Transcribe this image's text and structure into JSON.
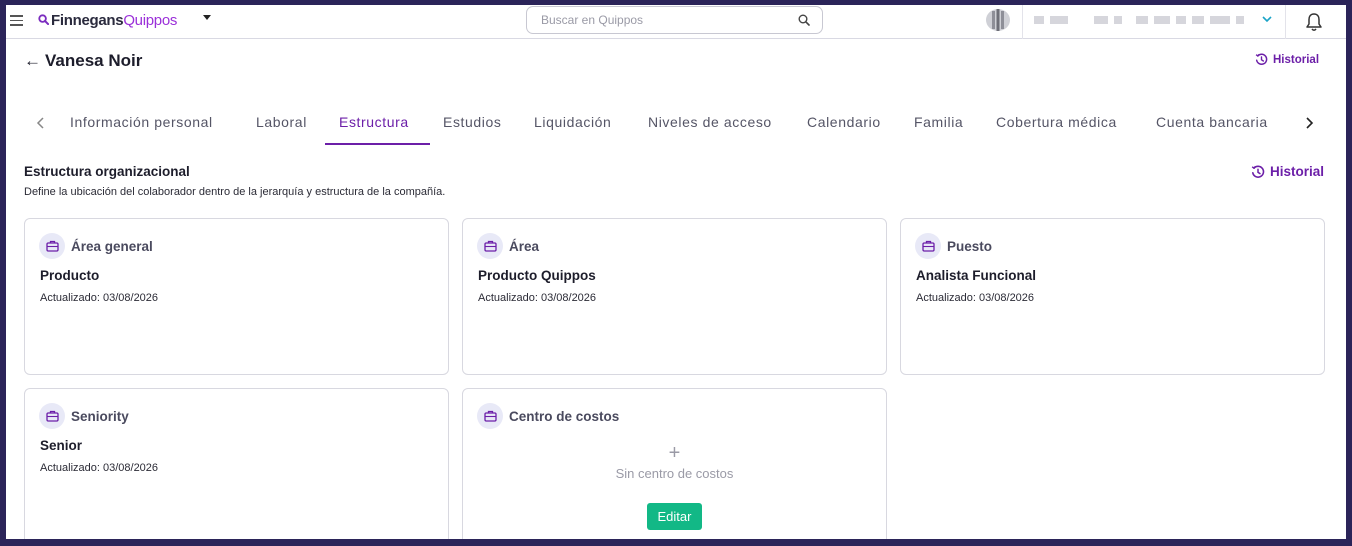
{
  "topbar": {
    "brand_part1": "Finnegans",
    "brand_part2": "Quippos",
    "search_placeholder": "Buscar en Quippos"
  },
  "header": {
    "employee_name": "Vanesa Noir",
    "history_label": "Historial"
  },
  "tabs": [
    {
      "label": "Información personal",
      "active": false
    },
    {
      "label": "Laboral",
      "active": false
    },
    {
      "label": "Estructura",
      "active": true
    },
    {
      "label": "Estudios",
      "active": false
    },
    {
      "label": "Liquidación",
      "active": false
    },
    {
      "label": "Niveles de acceso",
      "active": false
    },
    {
      "label": "Calendario",
      "active": false
    },
    {
      "label": "Familia",
      "active": false
    },
    {
      "label": "Cobertura médica",
      "active": false
    },
    {
      "label": "Cuenta bancaria",
      "active": false
    }
  ],
  "section": {
    "title": "Estructura organizacional",
    "subtitle": "Define la ubicación del colaborador dentro de la jerarquía y estructura de la compañía.",
    "history_label": "Historial"
  },
  "cards": [
    {
      "title": "Área general",
      "value": "Producto",
      "updated": "Actualizado: 03/08/2026"
    },
    {
      "title": "Área",
      "value": "Producto Quippos",
      "updated": "Actualizado: 03/08/2026"
    },
    {
      "title": "Puesto",
      "value": "Analista Funcional",
      "updated": "Actualizado: 03/08/2026"
    },
    {
      "title": "Seniority",
      "value": "Senior",
      "updated": "Actualizado: 03/08/2026"
    },
    {
      "title": "Centro de costos",
      "plus": "+",
      "empty_text": "Sin centro de costos",
      "edit_label": "Editar"
    }
  ],
  "colors": {
    "accent": "#6c1fa8",
    "brand_purple": "#9b30d9",
    "edit_button": "#12b886",
    "frame_border": "#2b2459"
  },
  "icons": {
    "menu": "hamburger-icon",
    "search": "search-icon",
    "notifications": "bell-icon",
    "back": "arrow-left-icon",
    "history": "history-icon",
    "card": "briefcase-icon"
  }
}
